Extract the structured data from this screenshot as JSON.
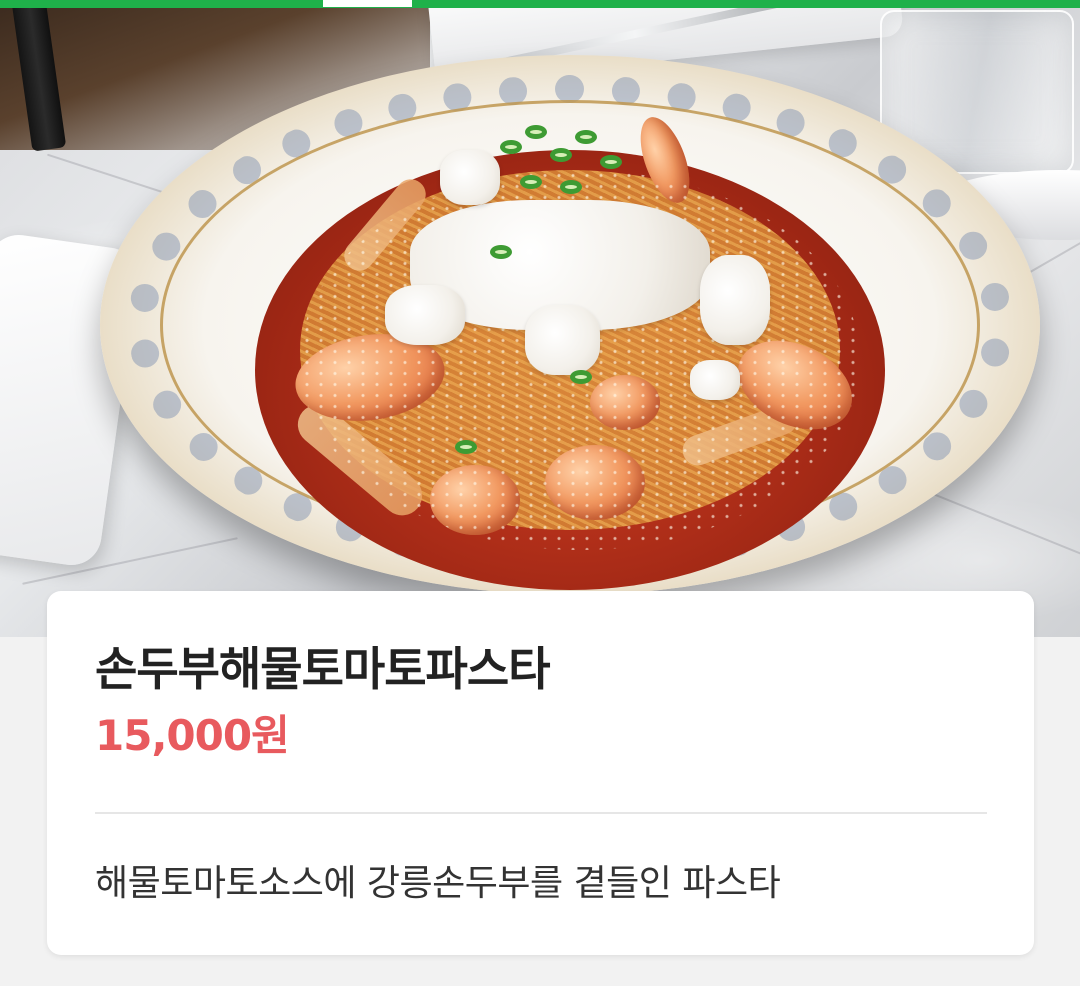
{
  "indicator": {
    "bar_color": "#1fb14a",
    "active_segment_color": "#ffffff"
  },
  "photo": {
    "subject": "seafood-tomato-pasta-with-tofu"
  },
  "menu_item": {
    "name": "손두부해물토마토파스타",
    "price": "15,000원",
    "description": "해물토마토소스에 강릉손두부를 곁들인 파스타",
    "price_color": "#e85a5e"
  }
}
